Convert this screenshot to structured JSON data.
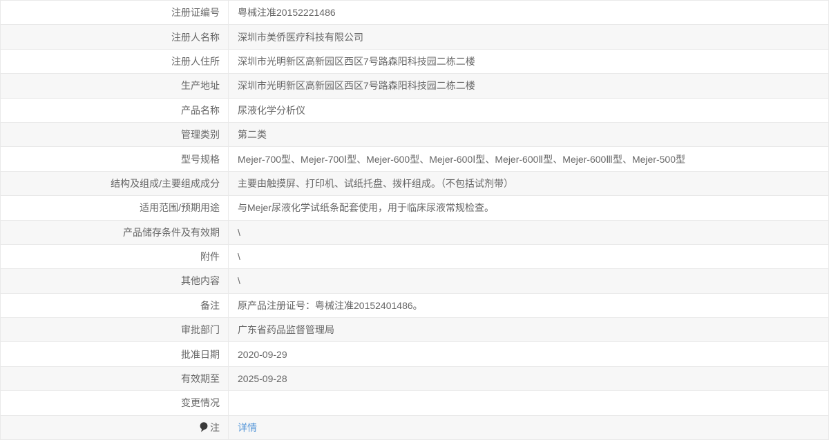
{
  "colors": {
    "alt_row_bg": "#f7f7f7",
    "border": "#e9e9e9",
    "text": "#666666",
    "link_blue": "#5596d8",
    "note_icon": "#3a3a3a"
  },
  "table": {
    "rows": [
      {
        "label": "注册证编号",
        "value": "粤械注准20152221486"
      },
      {
        "label": "注册人名称",
        "value": "深圳市美侨医疗科技有限公司"
      },
      {
        "label": "注册人住所",
        "value": "深圳市光明新区高新园区西区7号路森阳科技园二栋二楼"
      },
      {
        "label": "生产地址",
        "value": "深圳市光明新区高新园区西区7号路森阳科技园二栋二楼"
      },
      {
        "label": "产品名称",
        "value": "尿液化学分析仪"
      },
      {
        "label": "管理类别",
        "value": "第二类"
      },
      {
        "label": "型号规格",
        "value": "Mejer-700型、Mejer-700Ⅰ型、Mejer-600型、Mejer-600Ⅰ型、Mejer-600Ⅱ型、Mejer-600Ⅲ型、Mejer-500型"
      },
      {
        "label": "结构及组成/主要组成成分",
        "value": "主要由触摸屏、打印机、试纸托盘、拨杆组成。（不包括试剂带）"
      },
      {
        "label": "适用范围/预期用途",
        "value": "与Mejer尿液化学试纸条配套使用，用于临床尿液常规检查。"
      },
      {
        "label": "产品储存条件及有效期",
        "value": "\\"
      },
      {
        "label": "附件",
        "value": "\\"
      },
      {
        "label": "其他内容",
        "value": "\\"
      },
      {
        "label": "备注",
        "value": "原产品注册证号：粤械注准20152401486。"
      },
      {
        "label": "审批部门",
        "value": "广东省药品监督管理局"
      },
      {
        "label": "批准日期",
        "value": "2020-09-29"
      },
      {
        "label": "有效期至",
        "value": "2025-09-28"
      },
      {
        "label": "变更情况",
        "value": ""
      },
      {
        "label": "注",
        "value": "详情",
        "icon": "note-balloon-icon",
        "value_is_link": true
      }
    ]
  }
}
